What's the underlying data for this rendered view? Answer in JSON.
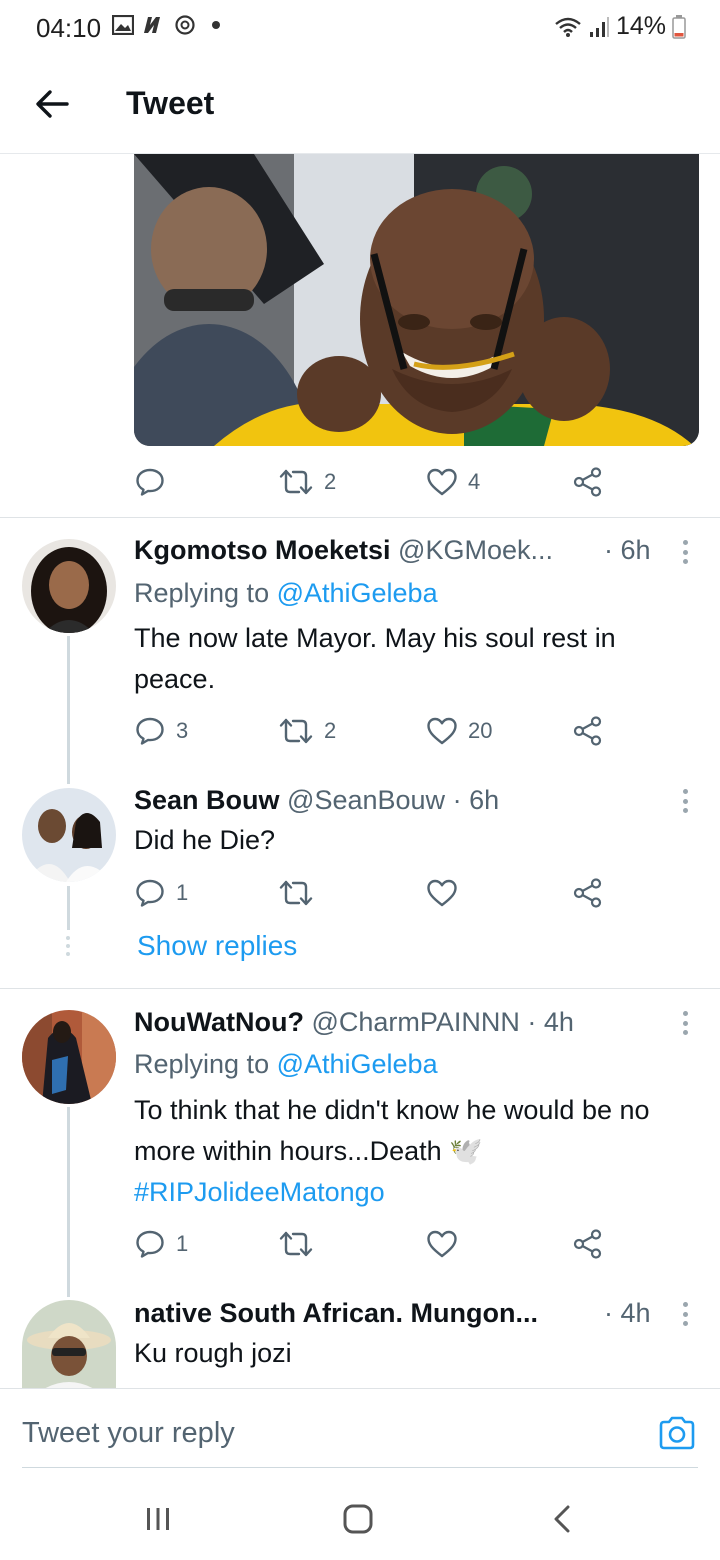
{
  "status_bar": {
    "time": "04:10",
    "battery": "14%",
    "icons": [
      "gallery-icon",
      "netflix-icon",
      "sync-icon",
      "dot-icon",
      "wifi-icon",
      "signal-icon",
      "battery-icon"
    ]
  },
  "header": {
    "title": "Tweet",
    "back_icon": "arrow-left-icon"
  },
  "main_tweet": {
    "retweets": "2",
    "likes": "4"
  },
  "replies": [
    {
      "name": "Kgomotso Moeketsi",
      "handle": "@KGMoek...",
      "time": "· 6h",
      "replying_prefix": "Replying to ",
      "replying_to": "@AthiGeleba",
      "text": "The now late Mayor. May his soul rest in peace.",
      "reply_count": "3",
      "retweet_count": "2",
      "like_count": "20"
    },
    {
      "name": "Sean Bouw",
      "handle": "@SeanBouw",
      "time": "· 6h",
      "text": "Did he Die?",
      "reply_count": "1",
      "retweet_count": "",
      "like_count": ""
    },
    {
      "name": "NouWatNou?",
      "handle": "@CharmPAINNN",
      "time": "· 4h",
      "replying_prefix": "Replying to ",
      "replying_to": "@AthiGeleba",
      "text": "To think that he didn't know he would be no more within hours...Death 🕊️",
      "hashtag": "#RIPJolideeMatongo",
      "reply_count": "1",
      "retweet_count": "",
      "like_count": ""
    },
    {
      "name": "native South African. Mungon...",
      "handle": "",
      "time": "· 4h",
      "text": "Ku rough jozi"
    }
  ],
  "show_replies_label": "Show replies",
  "composer": {
    "placeholder": "Tweet your reply"
  },
  "colors": {
    "accent": "#1d9bf0",
    "secondary_text": "#536471",
    "primary_text": "#0f1419",
    "divider": "#dfe3e6"
  }
}
